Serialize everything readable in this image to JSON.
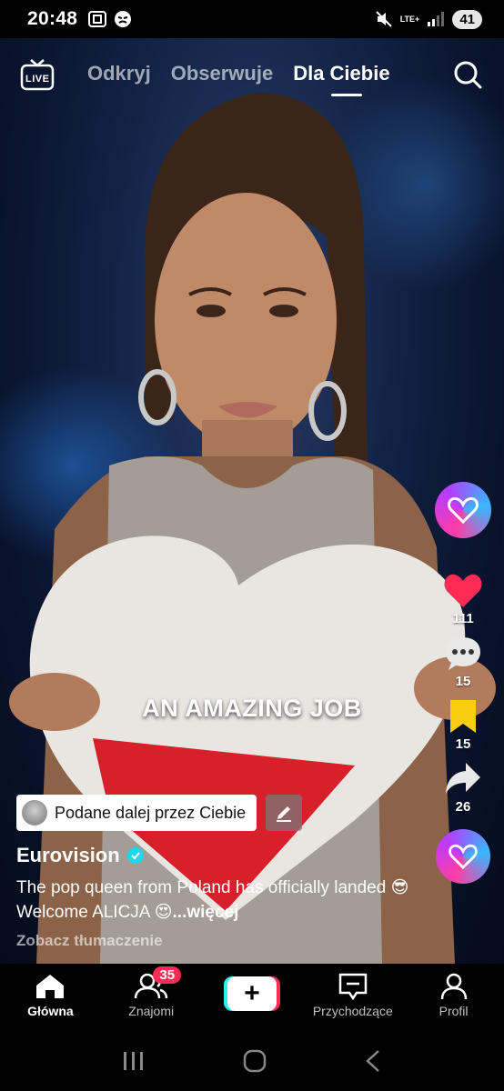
{
  "status_bar": {
    "time": "20:48",
    "network": "LTE+",
    "battery": "41",
    "icons": [
      "screenshot-icon",
      "app-notification-icon",
      "mute-icon",
      "signal-icon"
    ]
  },
  "top_nav": {
    "live_label": "LIVE",
    "tabs": [
      {
        "label": "Odkryj",
        "active": false
      },
      {
        "label": "Obserwuje",
        "active": false
      },
      {
        "label": "Dla Ciebie",
        "active": true
      }
    ]
  },
  "video": {
    "overlay_caption": "AN AMAZING JOB"
  },
  "actions": {
    "likes": "111",
    "comments": "15",
    "saves": "15",
    "shares": "26"
  },
  "post": {
    "repost_label": "Podane dalej przez Ciebie",
    "author": "Eurovision",
    "description": "The pop queen from Poland has officially landed 😎 Welcome ALICJA 😍",
    "more_label": "...więcej",
    "translate_label": "Zobacz tłumaczenie"
  },
  "bottom_nav": {
    "items": [
      {
        "label": "Główna",
        "icon": "home-icon",
        "active": true
      },
      {
        "label": "Znajomi",
        "icon": "friends-icon",
        "badge": "35"
      },
      {
        "label": "",
        "icon": "plus-icon"
      },
      {
        "label": "Przychodzące",
        "icon": "inbox-icon"
      },
      {
        "label": "Profil",
        "icon": "profile-icon"
      }
    ]
  },
  "colors": {
    "accent_red": "#fe2c55",
    "accent_cyan": "#25f4ee",
    "bookmark_yellow": "#facd12",
    "verified_blue": "#20d5ec"
  }
}
